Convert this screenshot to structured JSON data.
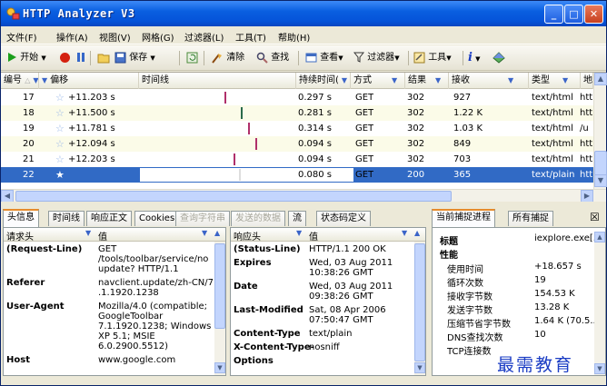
{
  "window": {
    "title": "HTTP Analyzer V3",
    "min": "_",
    "max": "□",
    "close": "✕"
  },
  "menu": [
    "文件(F)",
    "操作(A)",
    "视图(V)",
    "网格(G)",
    "过滤器(L)",
    "工具(T)",
    "帮助(H)"
  ],
  "toolbar": {
    "start": "开始",
    "save": "保存",
    "clear": "清除",
    "find": "查找",
    "view": "查看",
    "filter": "过滤器",
    "tools": "工具"
  },
  "grid": {
    "columns": [
      "编号",
      "偏移",
      "时间线",
      "持续时间(",
      "方式",
      "结果",
      "接收",
      "类型",
      "地"
    ],
    "rows": [
      {
        "id": "17",
        "offset": "+11.203 s",
        "duration": "0.297 s",
        "method": "GET",
        "result": "302",
        "received": "927",
        "type": "text/html",
        "addr": "htt"
      },
      {
        "id": "18",
        "offset": "+11.500 s",
        "duration": "0.281 s",
        "method": "GET",
        "result": "302",
        "received": "1.22 K",
        "type": "text/html",
        "addr": "htt"
      },
      {
        "id": "19",
        "offset": "+11.781 s",
        "duration": "0.314 s",
        "method": "GET",
        "result": "302",
        "received": "1.03 K",
        "type": "text/html",
        "addr": "/u"
      },
      {
        "id": "20",
        "offset": "+12.094 s",
        "duration": "0.094 s",
        "method": "GET",
        "result": "302",
        "received": "849",
        "type": "text/html",
        "addr": "htt"
      },
      {
        "id": "21",
        "offset": "+12.203 s",
        "duration": "0.094 s",
        "method": "GET",
        "result": "302",
        "received": "703",
        "type": "text/html",
        "addr": "htt"
      },
      {
        "id": "22",
        "offset": "",
        "duration": "0.080 s",
        "method": "GET",
        "result": "200",
        "received": "365",
        "type": "text/plain",
        "addr": "htt"
      }
    ]
  },
  "tabs": [
    "头信息",
    "时间线",
    "响应正文",
    "Cookies",
    "查询字符串",
    "发送的数据",
    "流",
    "状态码定义"
  ],
  "request": {
    "col_key": "请求头",
    "col_val": "值",
    "items": [
      {
        "key": "(Request-Line)",
        "val": [
          "GET",
          "/tools/toolbar/service/no",
          "update? HTTP/1.1"
        ]
      },
      {
        "key": "Referer",
        "val": [
          "navclient.update/zh-CN/7",
          ".1.1920.1238"
        ]
      },
      {
        "key": "User-Agent",
        "val": [
          "Mozilla/4.0 (compatible;",
          "GoogleToolbar",
          "7.1.1920.1238; Windows",
          "XP 5.1; MSIE",
          "6.0.2900.5512)"
        ]
      },
      {
        "key": "Host",
        "val": [
          "www.google.com"
        ]
      }
    ]
  },
  "response": {
    "col_key": "响应头",
    "col_val": "值",
    "items": [
      {
        "key": "(Status-Line)",
        "val": [
          "HTTP/1.1 200 OK"
        ]
      },
      {
        "key": "Expires",
        "val": [
          "Wed, 03 Aug 2011",
          "10:38:26 GMT"
        ]
      },
      {
        "key": "Date",
        "val": [
          "Wed, 03 Aug 2011",
          "09:38:26 GMT"
        ]
      },
      {
        "key": "Last-Modified",
        "val": [
          "Sat, 08 Apr 2006",
          "07:50:47 GMT"
        ]
      },
      {
        "key": "Content-Type",
        "val": [
          "text/plain"
        ]
      },
      {
        "key": "X-Content-Type-",
        "val": [
          "nosniff"
        ]
      },
      {
        "key": "Options",
        "val": [
          ""
        ]
      }
    ]
  },
  "capture": {
    "tab_current": "当前捕捉进程",
    "tab_all": "所有捕捉",
    "close": "☒",
    "title_label": "标题",
    "title_val": "iexplore.exe[...",
    "perf_label": "性能",
    "stats": [
      {
        "label": "使用时间",
        "val": "+18.657 s"
      },
      {
        "label": "循环次数",
        "val": "19"
      },
      {
        "label": "接收字节数",
        "val": "154.53 K"
      },
      {
        "label": "发送字节数",
        "val": "13.28 K"
      },
      {
        "label": "压缩节省字节数",
        "val": "1.64 K (70.5..."
      },
      {
        "label": "DNS查找次数",
        "val": "10"
      },
      {
        "label": "TCP连接数",
        "val": ""
      }
    ]
  },
  "watermark": "最需教育"
}
